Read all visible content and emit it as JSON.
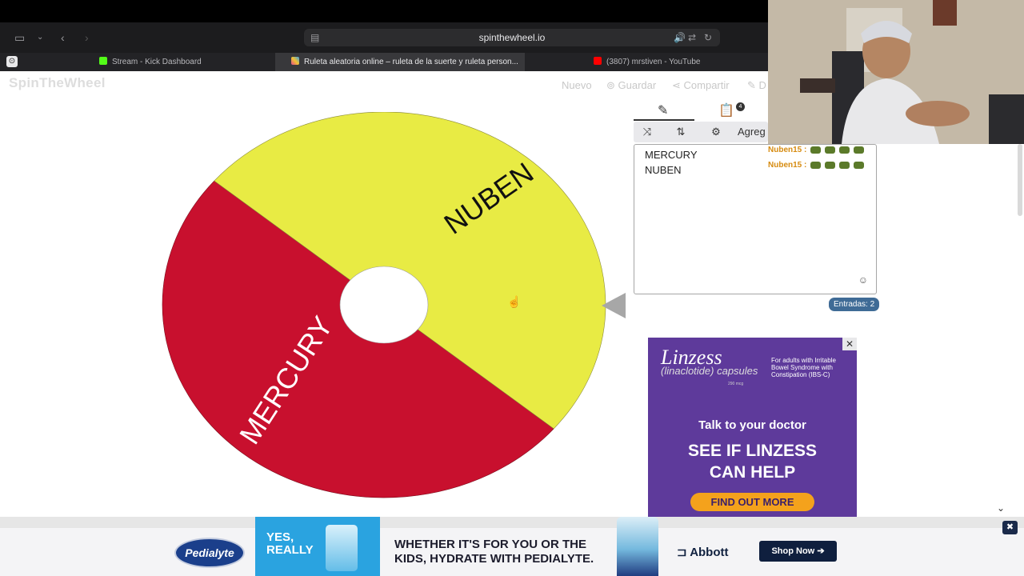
{
  "browser": {
    "url": "spinthewheel.io",
    "tabs": [
      {
        "title": "Stream - Kick Dashboard",
        "favicon_color": "#53fc18"
      },
      {
        "title": "Ruleta aleatoria online – ruleta de la suerte y ruleta person...",
        "favicon_color": "#e24a8d"
      },
      {
        "title": "(3807) mrstiven - YouTube",
        "favicon_color": "#ff0000"
      }
    ]
  },
  "app": {
    "logo": "SpinTheWheel",
    "menu": {
      "nuevo": "Nuevo",
      "guardar": "Guardar",
      "compartir": "Compartir",
      "d": "D"
    }
  },
  "wheel": {
    "segments": [
      {
        "label": "NUBEN",
        "color": "#e8eb44"
      },
      {
        "label": "MERCURY",
        "color": "#c8102e"
      }
    ]
  },
  "editor": {
    "toolbar": {
      "agregar": "Agreg"
    },
    "badge": "4",
    "entries": [
      "MERCURY",
      "NUBEN"
    ],
    "count_label": "Entradas: 2"
  },
  "overlay": {
    "chat_lines": [
      "Nuben15 :",
      "Nuben15 :"
    ]
  },
  "ad": {
    "brand": "Linzess",
    "brand_sub": "(linaclotide) capsules",
    "dose": "290 mcg",
    "note": "For adults with Irritable Bowel Syndrome with Constipation (IBS-C)",
    "talk": "Talk to your doctor",
    "see_line1": "SEE IF LINZESS",
    "see_line2": "CAN HELP",
    "cta": "FIND OUT MORE"
  },
  "bottom_ad": {
    "brand": "Pedialyte",
    "yes_line1": "YES,",
    "yes_line2": "REALLY",
    "copy_line1": "WHETHER IT'S FOR YOU OR THE",
    "copy_line2": "KIDS, HYDRATE WITH PEDIALYTE.",
    "sponsor": "Abbott",
    "cta": "Shop Now"
  },
  "colors": {
    "wheel_yellow": "#e8eb44",
    "wheel_red": "#c8102e",
    "entries_badge": "#3f6b96",
    "linzess_bg": "#5e3a9b",
    "linzess_cta": "#f4a21c"
  }
}
